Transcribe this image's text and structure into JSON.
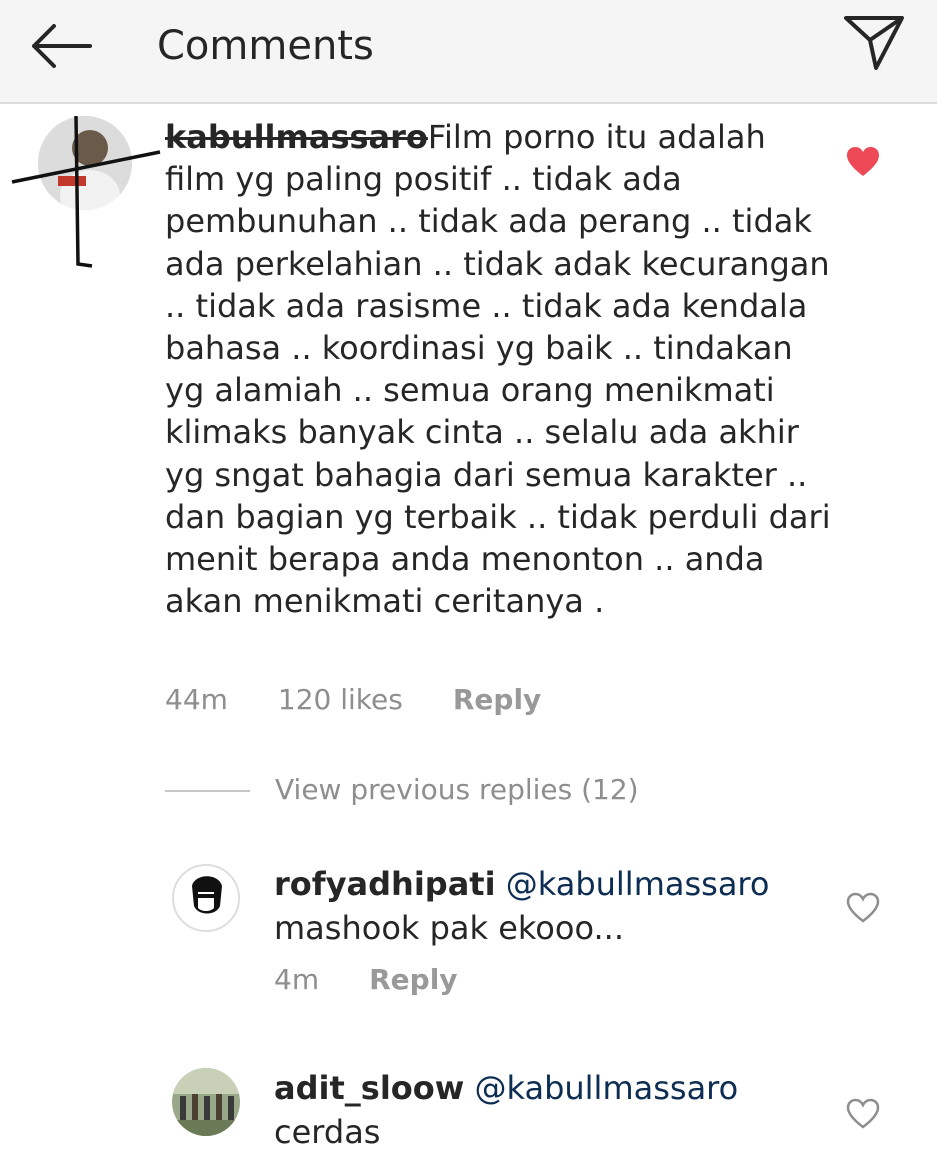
{
  "header": {
    "title": "Comments",
    "back_icon": "arrow-left-icon",
    "share_icon": "paper-plane-icon"
  },
  "main_comment": {
    "username": "kabullmassaro",
    "text": "Film porno itu adalah film yg paling positif .. tidak ada pembunuhan .. tidak ada perang .. tidak ada perkelahian .. tidak adak kecurangan .. tidak ada rasisme .. tidak ada kendala bahasa .. koordinasi yg baik .. tindakan yg alamiah .. semua orang menikmati klimaks banyak cinta .. selalu ada akhir yg sngat bahagia dari semua karakter .. dan bagian yg terbaik .. tidak perduli dari menit berapa anda menonton .. anda akan menikmati ceritanya .",
    "time": "44m",
    "likes": "120 likes",
    "reply_label": "Reply",
    "liked": true
  },
  "view_previous": "View previous replies (12)",
  "replies": [
    {
      "username": "rofyadhipati",
      "mention": "@kabullmassaro",
      "text": "mashook pak ekooo...",
      "time": "4m",
      "reply_label": "Reply",
      "liked": false
    },
    {
      "username": "adit_sloow",
      "mention": "@kabullmassaro",
      "text": "cerdas",
      "liked": false
    }
  ],
  "colors": {
    "heart_liked": "#ed4956",
    "mention": "#0d2d52",
    "meta_gray": "#8e8e8e",
    "header_bg": "#f5f5f5"
  }
}
